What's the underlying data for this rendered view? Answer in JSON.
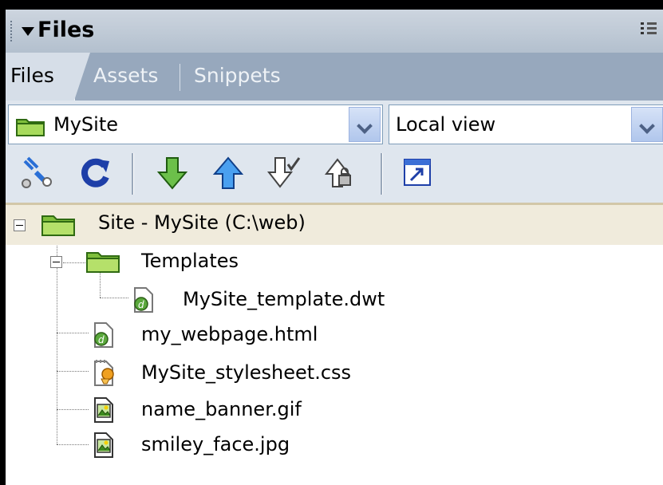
{
  "panel": {
    "title": "Files"
  },
  "tabs": [
    {
      "label": "Files",
      "active": true
    },
    {
      "label": "Assets",
      "active": false
    },
    {
      "label": "Snippets",
      "active": false
    }
  ],
  "site_select": {
    "value": "MySite"
  },
  "view_select": {
    "value": "Local view"
  },
  "toolbar": {
    "buttons": [
      "connect-icon",
      "refresh-icon",
      "get-files-icon",
      "put-files-icon",
      "check-out-icon",
      "check-in-icon",
      "expand-panel-icon"
    ]
  },
  "tree": {
    "root": {
      "label": "Site - MySite (C:\\web)"
    },
    "templates_folder": {
      "label": "Templates"
    },
    "items": [
      {
        "label": "MySite_template.dwt",
        "icon": "dreamweaver-file-icon"
      },
      {
        "label": "my_webpage.html",
        "icon": "dreamweaver-file-icon"
      },
      {
        "label": "MySite_stylesheet.css",
        "icon": "css-file-icon"
      },
      {
        "label": "name_banner.gif",
        "icon": "image-file-icon"
      },
      {
        "label": "smiley_face.jpg",
        "icon": "image-file-icon"
      }
    ]
  },
  "colors": {
    "titlebar": "#b3c0ce",
    "tabbar": "#97a8bd",
    "toolbar": "#dfe6ee",
    "root_row": "#f0ebdc",
    "accent_green": "#5aa83c",
    "accent_blue": "#2a6fd6"
  }
}
